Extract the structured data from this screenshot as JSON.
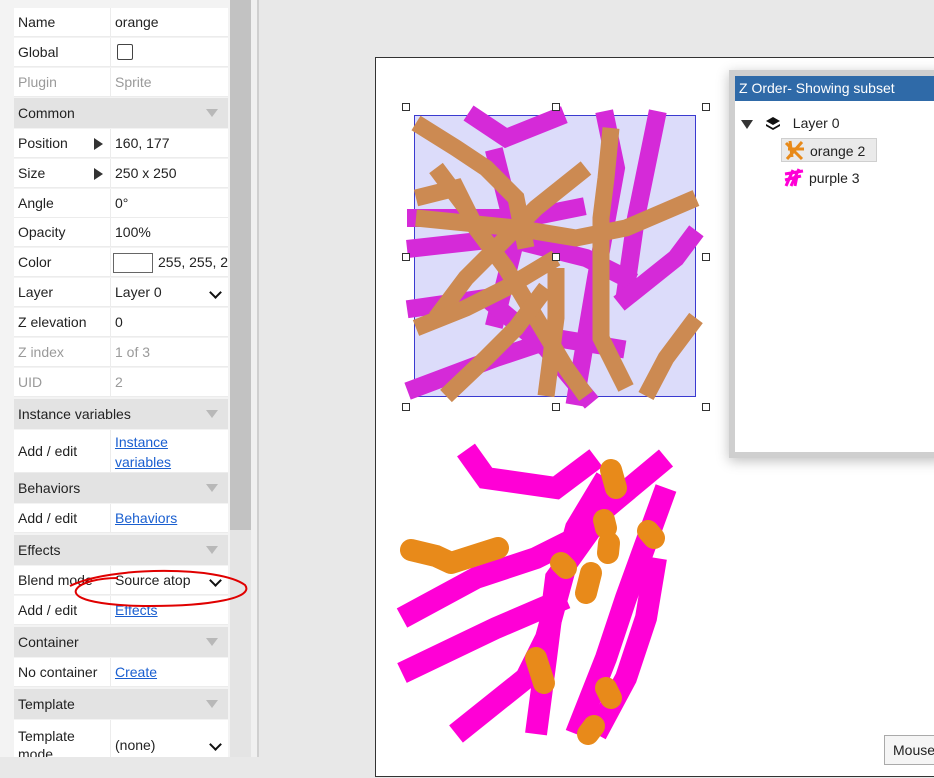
{
  "properties": {
    "name": {
      "label": "Name",
      "value": "orange"
    },
    "global": {
      "label": "Global",
      "checked": false
    },
    "plugin": {
      "label": "Plugin",
      "value": "Sprite"
    },
    "common_section": "Common",
    "position": {
      "label": "Position",
      "value": "160, 177"
    },
    "size": {
      "label": "Size",
      "value": "250 x 250"
    },
    "angle": {
      "label": "Angle",
      "value": "0°"
    },
    "opacity": {
      "label": "Opacity",
      "value": "100%"
    },
    "color": {
      "label": "Color",
      "value": "255, 255, 2",
      "swatch": "#ffffff"
    },
    "layer": {
      "label": "Layer",
      "value": "Layer 0"
    },
    "z_elevation": {
      "label": "Z elevation",
      "value": "0"
    },
    "z_index": {
      "label": "Z index",
      "value": "1 of 3"
    },
    "uid": {
      "label": "UID",
      "value": "2"
    },
    "instance_variables_section": "Instance variables",
    "instance_variables": {
      "label": "Add / edit",
      "link_line1": "Instance",
      "link_line2": "variables"
    },
    "behaviors_section": "Behaviors",
    "behaviors": {
      "label": "Add / edit",
      "link": "Behaviors"
    },
    "effects_section": "Effects",
    "blend_mode": {
      "label": "Blend mode",
      "value": "Source atop"
    },
    "effects": {
      "label": "Add / edit",
      "link": "Effects"
    },
    "container_section": "Container",
    "container": {
      "label": "No container",
      "link": "Create"
    },
    "template_section": "Template",
    "template_mode": {
      "label_line1": "Template",
      "label_line2": "mode",
      "value": "(none)"
    }
  },
  "z_order_panel": {
    "title": "Z Order- Showing subset",
    "layer": "Layer 0",
    "items": [
      {
        "label": "orange 2",
        "selected": true,
        "icon": "orange-sprite-icon"
      },
      {
        "label": "purple 3",
        "selected": false,
        "icon": "purple-sprite-icon"
      }
    ]
  },
  "mouse_button": "Mouse",
  "colors": {
    "orange": "#cc8a52",
    "magenta": "#d52ad8",
    "bright_magenta": "#ff00d6",
    "blob_orange": "#e88a1a",
    "selection_fill": "#dcdcfa",
    "annotation_red": "#e00000",
    "panel_title": "#2f6aa8"
  }
}
